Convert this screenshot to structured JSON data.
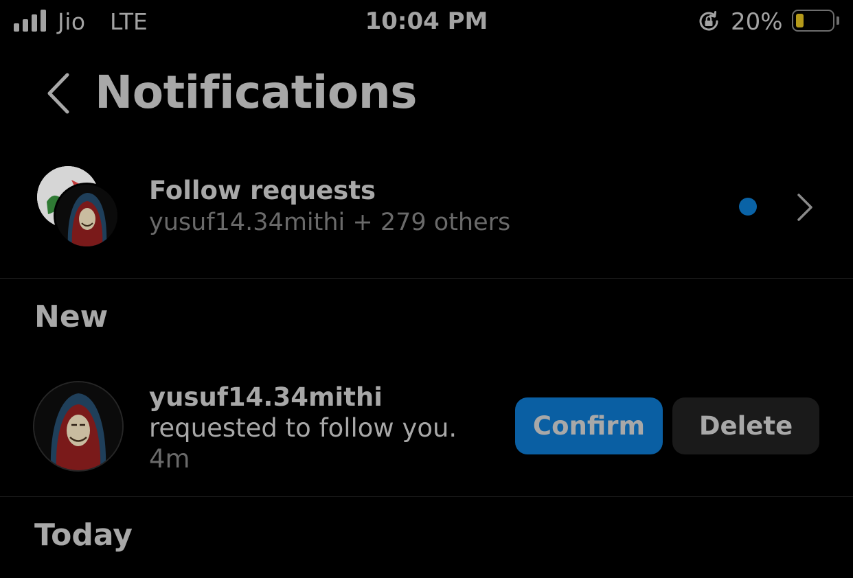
{
  "status_bar": {
    "carrier": "Jio",
    "network": "LTE",
    "time": "10:04 PM",
    "battery_percent": "20%",
    "battery_level": 0.2,
    "signal_bars": 4
  },
  "header": {
    "title": "Notifications",
    "back_icon": "chevron-left-icon"
  },
  "follow_requests": {
    "title": "Follow requests",
    "subtitle": "yusuf14.34mithi + 279 others",
    "unread_dot_color": "#0a63a6"
  },
  "sections": {
    "new": "New",
    "today": "Today"
  },
  "notification": {
    "username": "yusuf14.34mithi",
    "message": "requested to follow you.",
    "time": "4m",
    "confirm_label": "Confirm",
    "delete_label": "Delete"
  },
  "colors": {
    "background": "#000000",
    "text_primary": "#a8a8a8",
    "text_secondary": "#6a6a6a",
    "accent": "#0a5fa3",
    "button_secondary": "#1a1a1a"
  }
}
